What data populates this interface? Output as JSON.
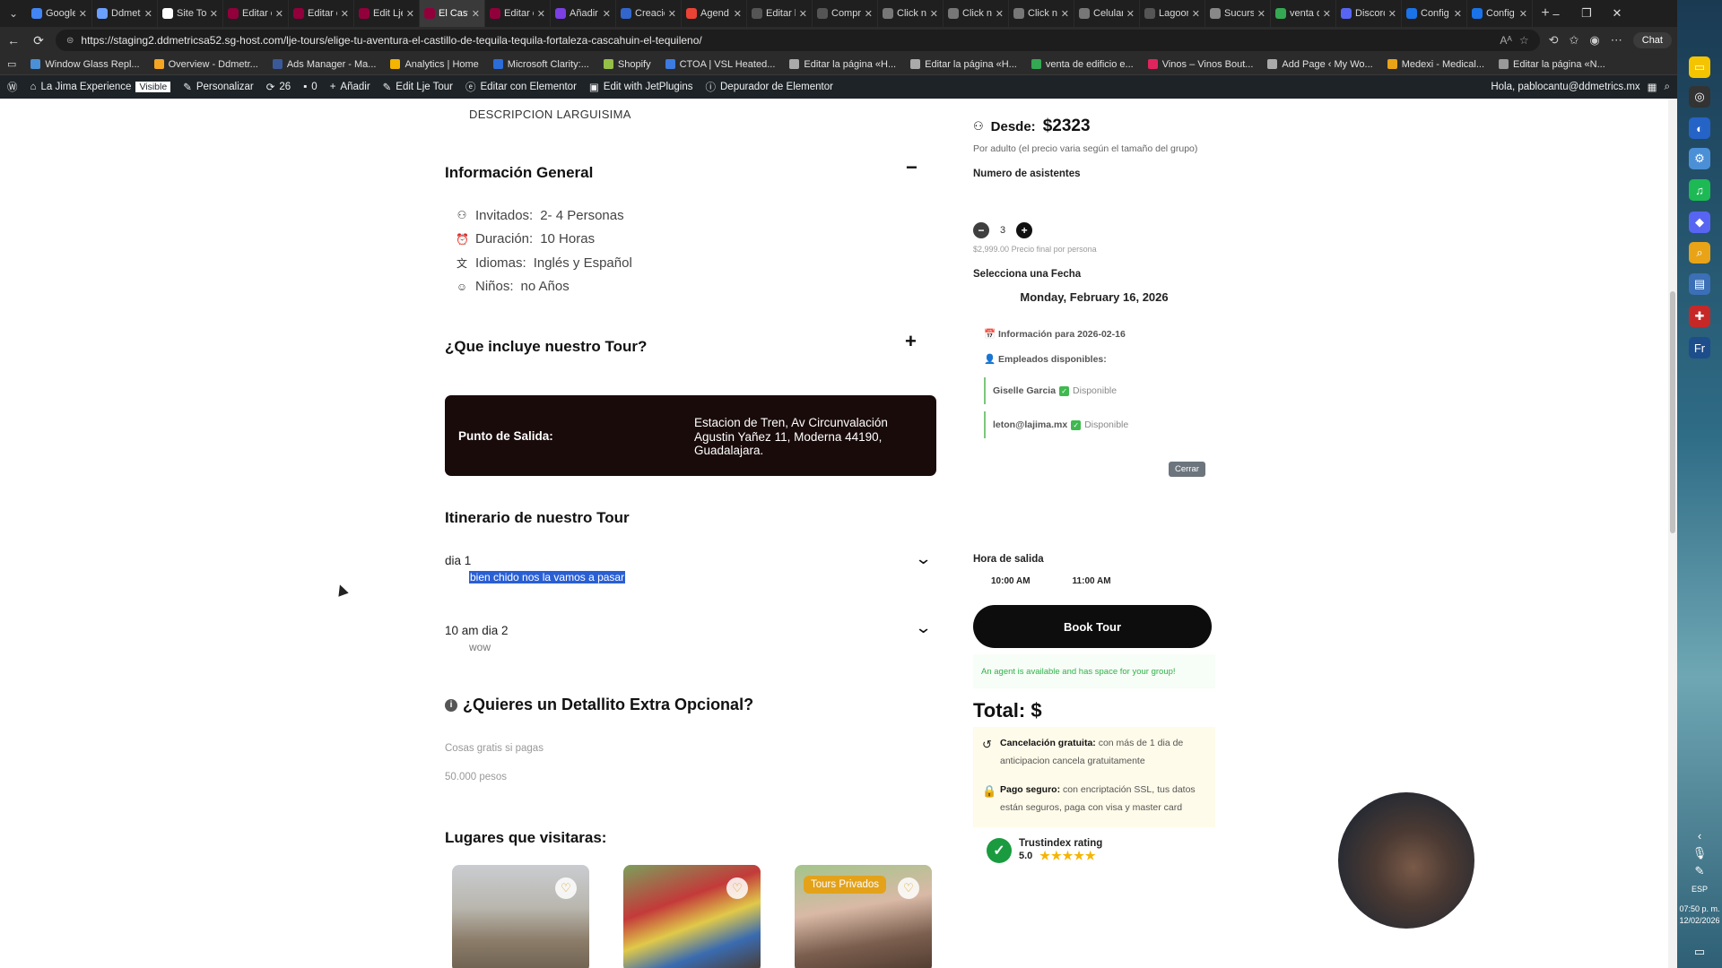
{
  "browser": {
    "tabs": [
      {
        "label": "Google",
        "color": "#4285f4",
        "active": false
      },
      {
        "label": "Ddmetr",
        "color": "#6aa0ff",
        "active": false
      },
      {
        "label": "Site To",
        "color": "#ffffff",
        "active": false
      },
      {
        "label": "Editar e",
        "color": "#92003b",
        "active": false
      },
      {
        "label": "Editar e",
        "color": "#92003b",
        "active": false
      },
      {
        "label": "Edit Lje",
        "color": "#92003b",
        "active": false
      },
      {
        "label": "El Casti",
        "color": "#92003b",
        "active": true
      },
      {
        "label": "Editar e",
        "color": "#92003b",
        "active": false
      },
      {
        "label": "Añadir",
        "color": "#7b3fe4",
        "active": false
      },
      {
        "label": "Creació",
        "color": "#3366cc",
        "active": false
      },
      {
        "label": "Agend",
        "color": "#ea4335",
        "active": false
      },
      {
        "label": "Editar l",
        "color": "#555555",
        "active": false
      },
      {
        "label": "Compr",
        "color": "#555555",
        "active": false
      },
      {
        "label": "Click n",
        "color": "#777777",
        "active": false
      },
      {
        "label": "Click n",
        "color": "#777777",
        "active": false
      },
      {
        "label": "Click n",
        "color": "#777777",
        "active": false
      },
      {
        "label": "Celular",
        "color": "#777777",
        "active": false
      },
      {
        "label": "Lagoon",
        "color": "#555555",
        "active": false
      },
      {
        "label": "Sucurs",
        "color": "#888888",
        "active": false
      },
      {
        "label": "venta d",
        "color": "#34a853",
        "active": false
      },
      {
        "label": "Discord",
        "color": "#5865f2",
        "active": false
      },
      {
        "label": "Config",
        "color": "#1a73e8",
        "active": false
      },
      {
        "label": "Config",
        "color": "#1a73e8",
        "active": false
      }
    ],
    "url": "https://staging2.ddmetricsa52.sg-host.com/lje-tours/elige-tu-aventura-el-castillo-de-tequila-tequila-fortaleza-cascahuin-el-tequileno/",
    "chat_label": "Chat",
    "bookmarks": [
      "Window Glass Repl...",
      "Overview - Ddmetr...",
      "Ads Manager - Ma...",
      "Analytics | Home",
      "Microsoft Clarity:...",
      "Shopify",
      "CTOA | VSL Heated...",
      "Editar la página «H...",
      "Editar la página «H...",
      "venta de edificio e...",
      "Vinos – Vinos Bout...",
      "Add Page ‹ My Wo...",
      "Medexi - Medical...",
      "Editar la página «N..."
    ]
  },
  "wp_admin": {
    "site": "La Jima Experience",
    "visible": "Visible",
    "customize": "Personalizar",
    "updates": "26",
    "comments": "0",
    "add": "Añadir",
    "edit_tour": "Edit Lje Tour",
    "elementor": "Editar con Elementor",
    "jet": "Edit with JetPlugins",
    "debugger": "Depurador de Elementor",
    "greeting": "Hola, pablocantu@ddmetrics.mx"
  },
  "content": {
    "description": "DESCRIPCION LARGUISIMA",
    "general_title": "Información General",
    "info": [
      {
        "icon": "group-icon",
        "label": "Invitados:",
        "value": "2- 4 Personas"
      },
      {
        "icon": "alarm-icon",
        "label": "Duración:",
        "value": "10 Horas"
      },
      {
        "icon": "language-icon",
        "label": "Idiomas:",
        "value": "Inglés y Español"
      },
      {
        "icon": "child-icon",
        "label": "Niños:",
        "value": "no Años"
      }
    ],
    "includes_title": "¿Que incluye nuestro Tour?",
    "salida_label": "Punto de Salida:",
    "salida_value": "Estacion de Tren, Av Circunvalación Agustin Yañez 11, Moderna 44190, Guadalajara.",
    "itinerary_title": "Itinerario de nuestro Tour",
    "days": [
      {
        "title": "dia 1",
        "desc": "bien chido nos la vamos a pasar"
      },
      {
        "title": "10 am dia 2",
        "desc": "wow"
      }
    ],
    "extra_title": "¿Quieres un Detallito Extra Opcional?",
    "extra_desc": "Cosas gratis si pagas",
    "extra_price": "50.000 pesos",
    "places_title": "Lugares que visitaras:",
    "card_badge": "Tours Privados"
  },
  "booking": {
    "desde_label": "Desde:",
    "desde_price": "$2323",
    "per_adult": "Por adulto (el precio varia según el tamaño del grupo)",
    "attendees_label": "Numero de asistentes",
    "attendees": "3",
    "final_price": "$2,999.00",
    "final_price_label": "Precio final por persona",
    "select_date": "Selecciona una Fecha",
    "date": "Monday, February 16, 2026",
    "info_for": "Información para 2026-02-16",
    "employees_label": "Empleados disponibles:",
    "employees": [
      {
        "name": "Giselle Garcia",
        "status": "Disponible"
      },
      {
        "name": "leton@lajima.mx",
        "status": "Disponible"
      }
    ],
    "close": "Cerrar",
    "hour_label": "Hora de salida",
    "hours": [
      "10:00 AM",
      "11:00 AM"
    ],
    "book_button": "Book Tour",
    "agent_msg": "An agent is available and has space for your group!",
    "total": "Total: $",
    "cancel_title": "Cancelación gratuita:",
    "cancel_text": "con más de 1 dia de anticipacion cancela gratuitamente",
    "pay_title": "Pago seguro:",
    "pay_text": "con encriptación SSL, tus datos están seguros, paga con visa y master card",
    "trust_title": "Trustindex rating",
    "trust_score": "5.0",
    "trust_stars": "★★★★★"
  },
  "system": {
    "lang": "ESP",
    "time": "07:50 p. m.",
    "date": "12/02/2026"
  }
}
